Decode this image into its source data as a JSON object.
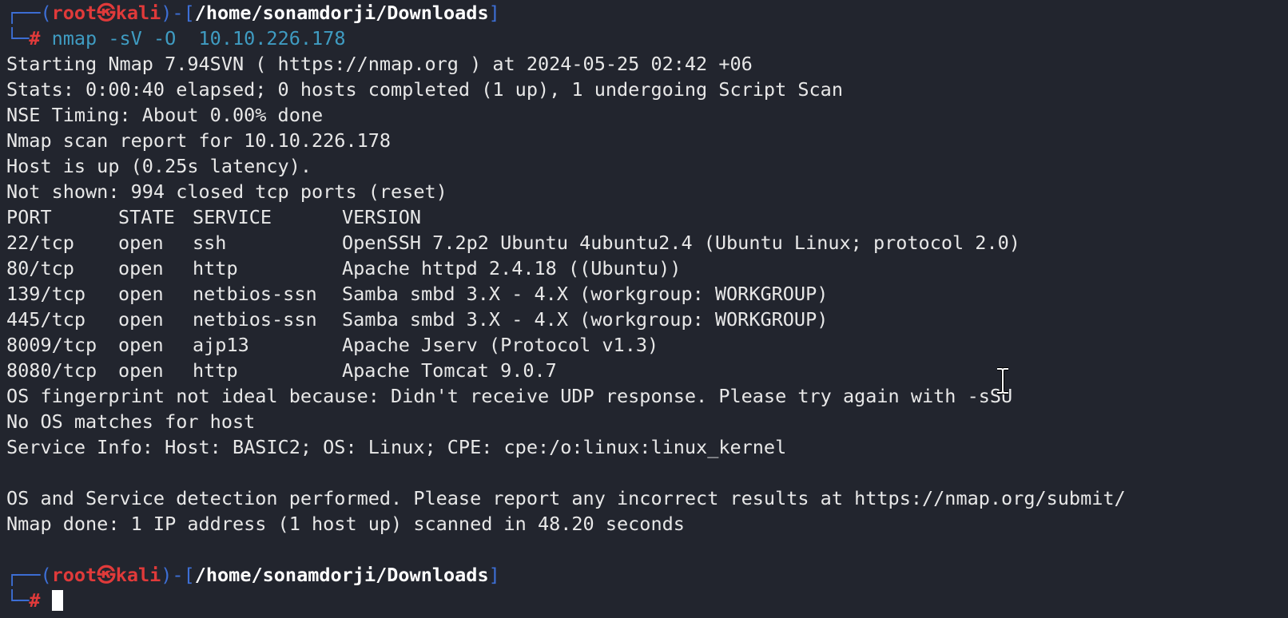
{
  "colors": {
    "background": "#22252e",
    "text": "#e8e8e8",
    "prompt_frame": "#3d6fd6",
    "prompt_user": "#e03a3a",
    "prompt_path": "#ffffff",
    "command": "#3f9cc2"
  },
  "prompt": {
    "frame_top": "┌──(",
    "user": "root",
    "at_symbol": "㉿",
    "host": "kali",
    "frame_mid": ")-[",
    "path": "/home/sonamdorji/Downloads",
    "frame_end": "]",
    "frame_bottom": "└─",
    "hash": "#"
  },
  "command": "nmap -sV -O  10.10.226.178",
  "output_before_table": [
    "Starting Nmap 7.94SVN ( https://nmap.org ) at 2024-05-25 02:42 +06",
    "Stats: 0:00:40 elapsed; 0 hosts completed (1 up), 1 undergoing Script Scan",
    "NSE Timing: About 0.00% done",
    "Nmap scan report for 10.10.226.178",
    "Host is up (0.25s latency).",
    "Not shown: 994 closed tcp ports (reset)"
  ],
  "ports_table": {
    "headers": [
      "PORT",
      "STATE",
      "SERVICE",
      "VERSION"
    ],
    "rows": [
      [
        "22/tcp",
        "open",
        "ssh",
        "OpenSSH 7.2p2 Ubuntu 4ubuntu2.4 (Ubuntu Linux; protocol 2.0)"
      ],
      [
        "80/tcp",
        "open",
        "http",
        "Apache httpd 2.4.18 ((Ubuntu))"
      ],
      [
        "139/tcp",
        "open",
        "netbios-ssn",
        "Samba smbd 3.X - 4.X (workgroup: WORKGROUP)"
      ],
      [
        "445/tcp",
        "open",
        "netbios-ssn",
        "Samba smbd 3.X - 4.X (workgroup: WORKGROUP)"
      ],
      [
        "8009/tcp",
        "open",
        "ajp13",
        "Apache Jserv (Protocol v1.3)"
      ],
      [
        "8080/tcp",
        "open",
        "http",
        "Apache Tomcat 9.0.7"
      ]
    ]
  },
  "output_after_table": [
    "OS fingerprint not ideal because: Didn't receive UDP response. Please try again with -sSU",
    "No OS matches for host",
    "Service Info: Host: BASIC2; OS: Linux; CPE: cpe:/o:linux:linux_kernel",
    "",
    "OS and Service detection performed. Please report any incorrect results at https://nmap.org/submit/",
    "Nmap done: 1 IP address (1 host up) scanned in 48.20 seconds"
  ]
}
